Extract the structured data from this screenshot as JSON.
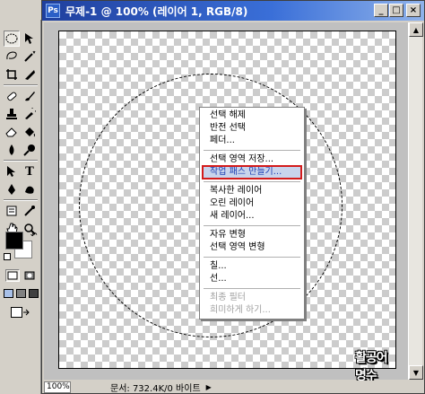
{
  "window": {
    "title": "무제-1 @ 100% (레이어 1, RGB/8)",
    "icon_text": "Ps",
    "minimize": "_",
    "maximize": "□",
    "close": "×"
  },
  "context_menu": {
    "items": [
      {
        "label": "선택 해제",
        "enabled": true
      },
      {
        "label": "반전 선택",
        "enabled": true
      },
      {
        "label": "페더...",
        "enabled": true
      },
      {
        "separator": true
      },
      {
        "label": "선택 영역 저장...",
        "enabled": true
      },
      {
        "label": "작업 패스 만들기...",
        "enabled": true,
        "highlighted": true
      },
      {
        "separator": true
      },
      {
        "label": "복사한 레이어",
        "enabled": true
      },
      {
        "label": "오린 레이어",
        "enabled": true
      },
      {
        "label": "새 레이어...",
        "enabled": true
      },
      {
        "separator": true
      },
      {
        "label": "자유 변형",
        "enabled": true
      },
      {
        "label": "선택 영역 변형",
        "enabled": true
      },
      {
        "separator": true
      },
      {
        "label": "칠...",
        "enabled": true
      },
      {
        "label": "선...",
        "enabled": true
      },
      {
        "separator": true
      },
      {
        "label": "최종 필터",
        "enabled": false
      },
      {
        "label": "희미하게 하기...",
        "enabled": false
      }
    ]
  },
  "watermark": "활공어 명수",
  "status": {
    "zoom": "100%",
    "doc_info": "문서: 732.4K/0 바이트"
  },
  "colors": {
    "menu_highlight_border": "#d31b1b",
    "menu_highlight_text": "#1d3fb3",
    "titlebar": "#1f3f9d"
  }
}
